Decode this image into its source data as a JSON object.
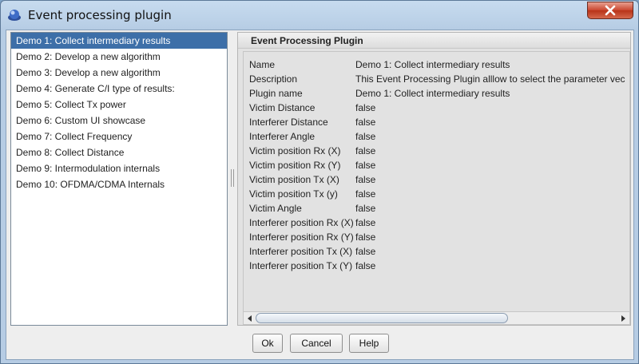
{
  "window": {
    "title": "Event processing plugin",
    "close_label": "✕"
  },
  "list": {
    "items": [
      {
        "label": "Demo 1: Collect intermediary results",
        "selected": true
      },
      {
        "label": "Demo 2: Develop a new algorithm",
        "selected": false
      },
      {
        "label": "Demo 3: Develop a new algorithm",
        "selected": false
      },
      {
        "label": "Demo 4: Generate C/I type of results:",
        "selected": false
      },
      {
        "label": "Demo 5: Collect Tx power",
        "selected": false
      },
      {
        "label": "Demo 6: Custom UI showcase",
        "selected": false
      },
      {
        "label": "Demo 7: Collect Frequency",
        "selected": false
      },
      {
        "label": "Demo 8: Collect Distance",
        "selected": false
      },
      {
        "label": "Demo 9: Intermodulation internals",
        "selected": false
      },
      {
        "label": "Demo 10: OFDMA/CDMA Internals",
        "selected": false
      }
    ]
  },
  "panel": {
    "header": "Event Processing Plugin",
    "properties": [
      {
        "key": "Name",
        "value": "Demo 1: Collect intermediary results"
      },
      {
        "key": "Description",
        "value": "This Event Processing Plugin alllow to select the parameter vec"
      },
      {
        "key": "Plugin name",
        "value": "Demo 1: Collect intermediary results"
      },
      {
        "key": "Victim Distance",
        "value": "false"
      },
      {
        "key": "Interferer Distance",
        "value": "false"
      },
      {
        "key": "Interferer Angle",
        "value": "false"
      },
      {
        "key": "Victim position Rx (X)",
        "value": "false"
      },
      {
        "key": "Victim position Rx (Y)",
        "value": "false"
      },
      {
        "key": "Victim position Tx (X)",
        "value": "false"
      },
      {
        "key": "Victim position Tx (y)",
        "value": "false"
      },
      {
        "key": "Victim Angle",
        "value": "false"
      },
      {
        "key": "Interferer position Rx (X)",
        "value": "false"
      },
      {
        "key": "Interferer position Rx (Y)",
        "value": "false"
      },
      {
        "key": "Interferer position Tx (X)",
        "value": "false"
      },
      {
        "key": "Interferer position Tx (Y)",
        "value": "false"
      }
    ]
  },
  "buttons": {
    "ok": "Ok",
    "cancel": "Cancel",
    "help": "Help"
  },
  "colors": {
    "selection": "#3d6fa8",
    "close_button": "#c9452e"
  }
}
